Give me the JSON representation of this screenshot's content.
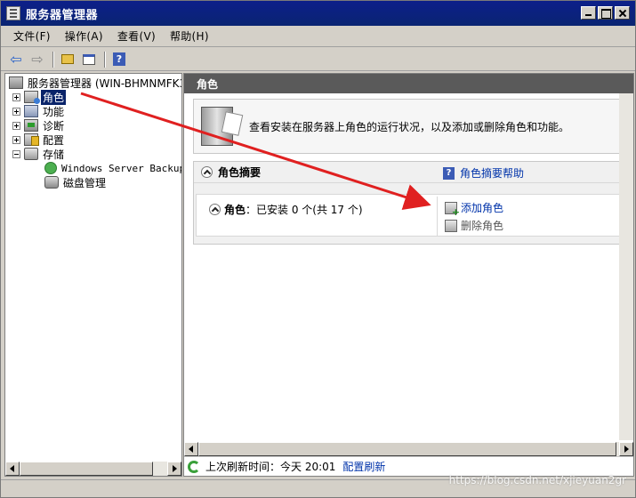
{
  "window": {
    "title": "服务器管理器"
  },
  "menu": [
    {
      "label": "文件(F)"
    },
    {
      "label": "操作(A)"
    },
    {
      "label": "查看(V)"
    },
    {
      "label": "帮助(H)"
    }
  ],
  "tree": {
    "root": "服务器管理器 (WIN-BHMNMFK33J",
    "items": [
      {
        "label": "角色",
        "selected": true
      },
      {
        "label": "功能"
      },
      {
        "label": "诊断"
      },
      {
        "label": "配置"
      },
      {
        "label": "存储"
      },
      {
        "label": "Windows Server Backup"
      },
      {
        "label": "磁盘管理"
      }
    ]
  },
  "right": {
    "header": "角色",
    "intro": "查看安装在服务器上角色的运行状况，以及添加或删除角色和功能。",
    "section_title": "角色摘要",
    "help_link": "角色摘要帮助",
    "roles_label": "角色",
    "roles_status": "：已安装 0 个(共 17 个)",
    "add_role": "添加角色",
    "remove_role": "删除角色"
  },
  "status": {
    "last_refresh": "上次刷新时间：今天 20:01",
    "config_refresh": "配置刷新"
  },
  "watermark": "https://blog.csdn.net/xjieyuan2gr",
  "colors": {
    "accent": "#0a246a",
    "link": "#0033aa",
    "arrow": "#e02020"
  }
}
